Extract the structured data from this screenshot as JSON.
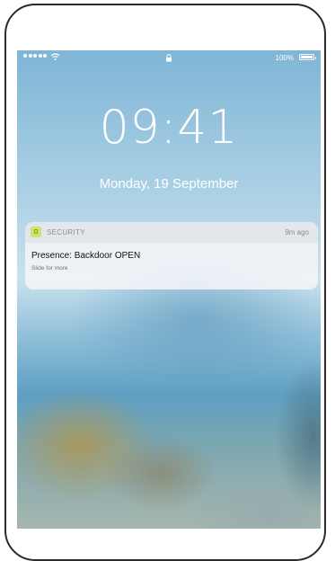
{
  "status_bar": {
    "signal_icon": "signal-dots-icon",
    "wifi_icon": "wifi-icon",
    "lock_icon": "lock-icon",
    "battery_percent": "100%",
    "battery_icon": "battery-icon"
  },
  "lock_screen": {
    "time": "09:41",
    "date": "Monday, 19 September"
  },
  "notification": {
    "app_icon": "security-app-icon",
    "app_name": "SECURITY",
    "time": "9m ago",
    "title": "Presence: Backdoor OPEN",
    "hint": "Slide for more"
  },
  "colors": {
    "app_icon_bg": "#cfe36a",
    "frame": "#2a2a2a"
  }
}
